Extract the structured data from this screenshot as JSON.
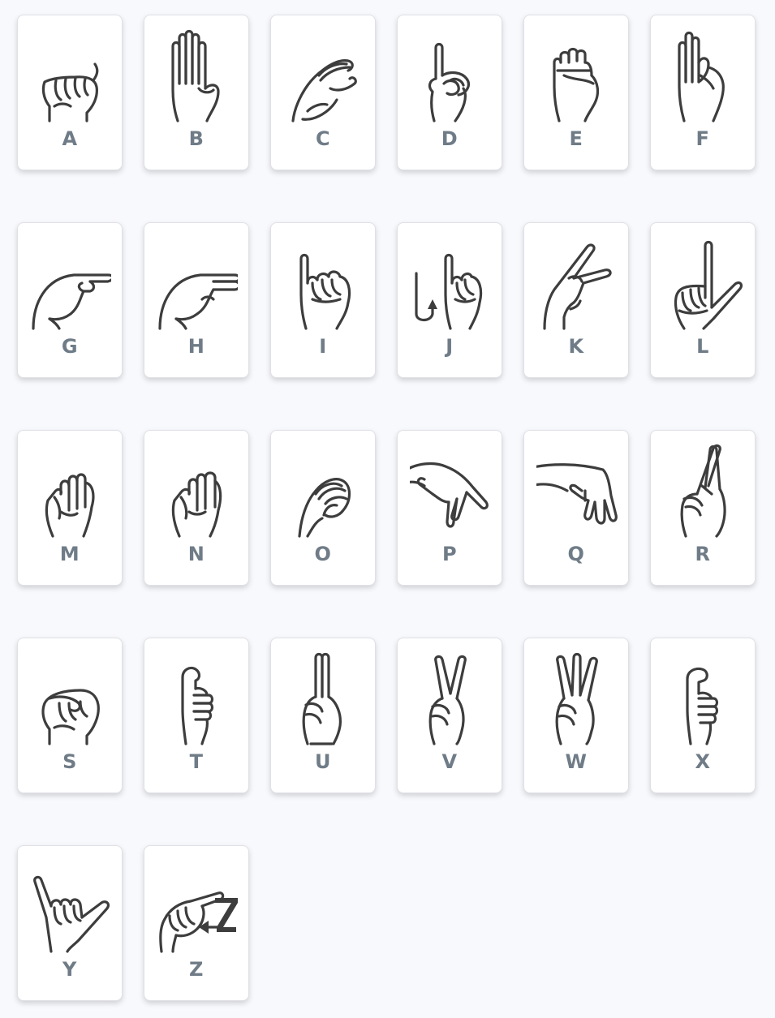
{
  "letters": [
    {
      "letter": "A",
      "icon": "asl-a-icon"
    },
    {
      "letter": "B",
      "icon": "asl-b-icon"
    },
    {
      "letter": "C",
      "icon": "asl-c-icon"
    },
    {
      "letter": "D",
      "icon": "asl-d-icon"
    },
    {
      "letter": "E",
      "icon": "asl-e-icon"
    },
    {
      "letter": "F",
      "icon": "asl-f-icon"
    },
    {
      "letter": "G",
      "icon": "asl-g-icon"
    },
    {
      "letter": "H",
      "icon": "asl-h-icon"
    },
    {
      "letter": "I",
      "icon": "asl-i-icon"
    },
    {
      "letter": "J",
      "icon": "asl-j-icon"
    },
    {
      "letter": "K",
      "icon": "asl-k-icon"
    },
    {
      "letter": "L",
      "icon": "asl-l-icon"
    },
    {
      "letter": "M",
      "icon": "asl-m-icon"
    },
    {
      "letter": "N",
      "icon": "asl-n-icon"
    },
    {
      "letter": "O",
      "icon": "asl-o-icon"
    },
    {
      "letter": "P",
      "icon": "asl-p-icon"
    },
    {
      "letter": "Q",
      "icon": "asl-q-icon"
    },
    {
      "letter": "R",
      "icon": "asl-r-icon"
    },
    {
      "letter": "S",
      "icon": "asl-s-icon"
    },
    {
      "letter": "T",
      "icon": "asl-t-icon"
    },
    {
      "letter": "U",
      "icon": "asl-u-icon"
    },
    {
      "letter": "V",
      "icon": "asl-v-icon"
    },
    {
      "letter": "W",
      "icon": "asl-w-icon"
    },
    {
      "letter": "X",
      "icon": "asl-x-icon"
    },
    {
      "letter": "Y",
      "icon": "asl-y-icon"
    },
    {
      "letter": "Z",
      "icon": "asl-z-icon"
    }
  ],
  "colors": {
    "background": "#f8f9fd",
    "card": "#ffffff",
    "card_border": "#dfe1e6",
    "letter": "#6f7c87",
    "icon_stroke": "#3d3d3d"
  }
}
